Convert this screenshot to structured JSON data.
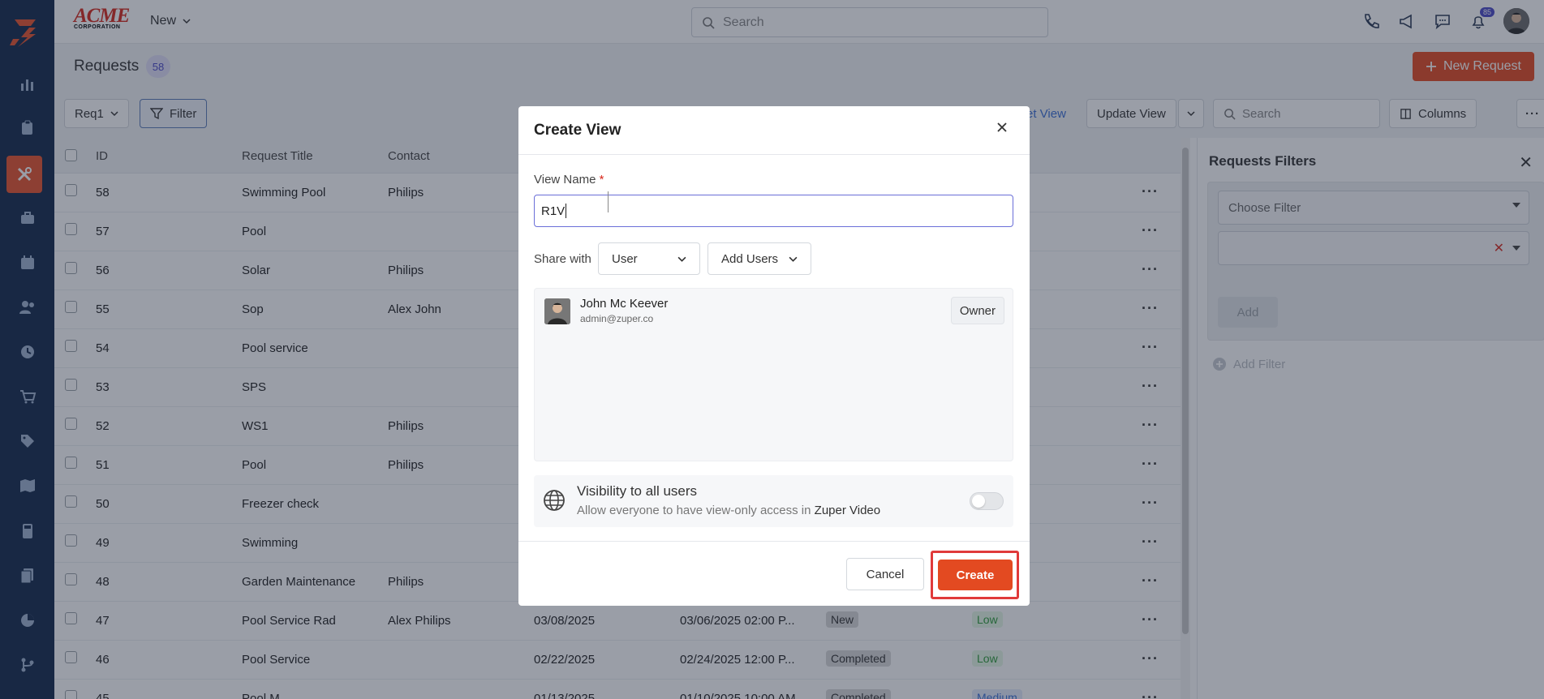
{
  "topbar": {
    "brand": {
      "name": "ACME",
      "sub": "CORPORATION"
    },
    "new_label": "New",
    "search_placeholder": "Search",
    "notification_count": "85"
  },
  "page": {
    "title": "Requests",
    "count": "58",
    "new_request_label": "New Request"
  },
  "toolbar": {
    "view_select": "Req1",
    "filter_label": "Filter",
    "set_view_partial": "et View",
    "update_view_label": "Update View",
    "search_placeholder": "Search",
    "columns_label": "Columns"
  },
  "table": {
    "headers": {
      "id": "ID",
      "title": "Request Title",
      "contact": "Contact"
    },
    "rows": [
      {
        "id": "58",
        "title": "Swimming Pool",
        "contact": "Philips",
        "date1": "",
        "date2": "",
        "status": "",
        "priority": ""
      },
      {
        "id": "57",
        "title": "Pool",
        "contact": "",
        "date1": "",
        "date2": "",
        "status": "",
        "priority": ""
      },
      {
        "id": "56",
        "title": "Solar",
        "contact": "Philips",
        "date1": "",
        "date2": "",
        "status": "",
        "priority": ""
      },
      {
        "id": "55",
        "title": "Sop",
        "contact": "Alex John",
        "date1": "",
        "date2": "",
        "status": "",
        "priority": ""
      },
      {
        "id": "54",
        "title": "Pool service",
        "contact": "",
        "date1": "",
        "date2": "",
        "status": "",
        "priority": ""
      },
      {
        "id": "53",
        "title": "SPS",
        "contact": "",
        "date1": "",
        "date2": "",
        "status": "",
        "priority": ""
      },
      {
        "id": "52",
        "title": "WS1",
        "contact": "Philips",
        "date1": "",
        "date2": "",
        "status": "",
        "priority": ""
      },
      {
        "id": "51",
        "title": "Pool",
        "contact": "Philips",
        "date1": "",
        "date2": "",
        "status": "",
        "priority": ""
      },
      {
        "id": "50",
        "title": "Freezer check",
        "contact": "",
        "date1": "",
        "date2": "",
        "status": "",
        "priority": ""
      },
      {
        "id": "49",
        "title": "Swimming",
        "contact": "",
        "date1": "",
        "date2": "",
        "status": "",
        "priority": ""
      },
      {
        "id": "48",
        "title": "Garden Maintenance",
        "contact": "Philips",
        "date1": "",
        "date2": "",
        "status": "",
        "priority": ""
      },
      {
        "id": "47",
        "title": "Pool Service Rad",
        "contact": "Alex Philips",
        "date1": "03/08/2025",
        "date2": "03/06/2025 02:00 P...",
        "status": "New",
        "priority": "Low"
      },
      {
        "id": "46",
        "title": "Pool Service",
        "contact": "",
        "date1": "02/22/2025",
        "date2": "02/24/2025 12:00 P...",
        "status": "Completed",
        "priority": "Low"
      },
      {
        "id": "45",
        "title": "Pool M",
        "contact": "",
        "date1": "01/13/2025",
        "date2": "01/10/2025 10:00 AM",
        "status": "Completed",
        "priority": "Medium"
      }
    ]
  },
  "filters_panel": {
    "title": "Requests Filters",
    "choose_filter": "Choose Filter",
    "add_label": "Add",
    "add_filter_label": "Add Filter"
  },
  "modal": {
    "title": "Create View",
    "view_name_label": "View Name",
    "required_mark": "*",
    "view_name_value": "R1V",
    "share_with_label": "Share with",
    "share_select": "User",
    "add_users_label": "Add Users",
    "user": {
      "name": "John Mc Keever",
      "email": "admin@zuper.co",
      "role": "Owner"
    },
    "visibility_title": "Visibility to all users",
    "visibility_desc": "Allow everyone to have view-only access in",
    "visibility_app": "Zuper Video",
    "cancel_label": "Cancel",
    "create_label": "Create"
  },
  "colors": {
    "accent": "#e34a21",
    "nav": "#13294b",
    "focus": "#6a6fd8"
  }
}
